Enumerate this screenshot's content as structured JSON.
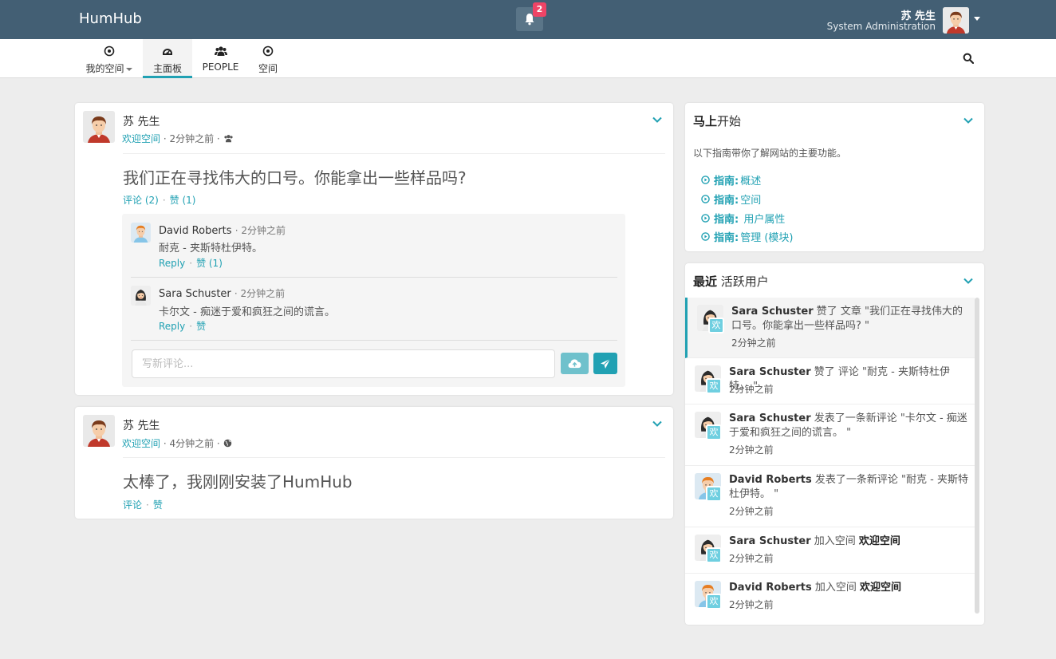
{
  "topbar": {
    "brand": "HumHub",
    "notification_count": "2",
    "user_name": "苏 先生",
    "user_role": "System Administration"
  },
  "nav": {
    "items": [
      {
        "label": "我的空间",
        "icon": "circle-dot-icon"
      },
      {
        "label": "主面板",
        "icon": "dashboard-icon"
      },
      {
        "label": "PEOPLE",
        "icon": "users-icon"
      },
      {
        "label": "空间",
        "icon": "circle-dot-icon"
      }
    ]
  },
  "posts": [
    {
      "author": "苏 先生",
      "space": "欢迎空间",
      "time": "· 2分钟之前 ·",
      "text": "我们正在寻找伟大的口号。你能拿出一些样品吗?",
      "comment_label": "评论 (2)",
      "like_label": "赞 (1)",
      "comments": [
        {
          "author": "David Roberts",
          "time": "· 2分钟之前",
          "text": "耐克 - 夹斯特杜伊特。",
          "reply": "Reply",
          "like": "赞 (1)"
        },
        {
          "author": "Sara Schuster",
          "time": "· 2分钟之前",
          "text": "卡尔文 - 痴迷于爱和疯狂之间的谎言。",
          "reply": "Reply",
          "like": "赞"
        }
      ],
      "comment_placeholder": "写新评论..."
    },
    {
      "author": "苏 先生",
      "space": "欢迎空间",
      "time": "· 4分钟之前 ·",
      "text": "太棒了，我刚刚安装了HumHub",
      "comment_label": "评论",
      "like_label": "赞"
    }
  ],
  "getting_started": {
    "title_bold": "马上",
    "title_rest": "开始",
    "description": "以下指南带你了解网站的主要功能。",
    "guide_prefix": "指南:",
    "guides": [
      "概述",
      "空间",
      " 用户属性",
      "管理 (模块)"
    ]
  },
  "activity": {
    "title_bold": "最近",
    "title_rest": " 活跃用户",
    "badge": "欢",
    "items": [
      {
        "who": "Sara Schuster",
        "action": " 赞了 文章 \"我们正在寻找伟大的口号。你能拿出一些样品吗? \"",
        "target": "",
        "time": "2分钟之前"
      },
      {
        "who": "Sara Schuster",
        "action": " 赞了 评论 \"耐克 - 夹斯特杜伊特。 \"",
        "target": "",
        "time": "2分钟之前"
      },
      {
        "who": "Sara Schuster",
        "action": " 发表了一条新评论 \"卡尔文 - 痴迷于爱和疯狂之间的谎言。 \"",
        "target": "",
        "time": "2分钟之前"
      },
      {
        "who": "David Roberts",
        "action": " 发表了一条新评论 \"耐克 - 夹斯特杜伊特。 \"",
        "target": "",
        "time": "2分钟之前"
      },
      {
        "who": "Sara Schuster",
        "action": " 加入空间 ",
        "target": "欢迎空间",
        "time": "2分钟之前"
      },
      {
        "who": "David Roberts",
        "action": " 加入空间 ",
        "target": "欢迎空间",
        "time": "2分钟之前"
      }
    ]
  },
  "colors": {
    "topbar": "#435f74",
    "accent": "#21a1b3",
    "badge": "#ee4466"
  }
}
